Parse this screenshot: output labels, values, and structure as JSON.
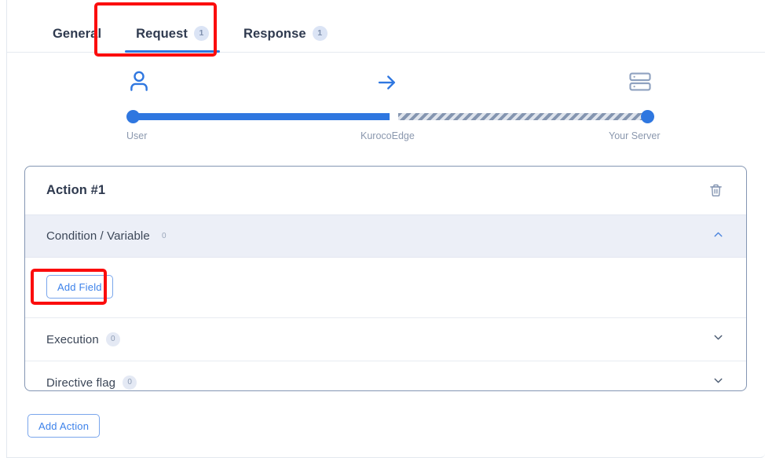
{
  "tabs": [
    {
      "label": "General",
      "badge": null,
      "active": false
    },
    {
      "label": "Request",
      "badge": "1",
      "active": true
    },
    {
      "label": "Response",
      "badge": "1",
      "active": false
    }
  ],
  "flow": {
    "user_icon": "user-icon",
    "arrow_icon": "arrow-right-icon",
    "server_icon": "server-icon",
    "labels": {
      "left": "User",
      "middle": "KurocoEdge",
      "right": "Your Server"
    },
    "colors": {
      "accent": "#2f77e0",
      "striped": "#8495b0",
      "label_text": "#8b98ae"
    }
  },
  "action_card": {
    "title": "Action #1",
    "delete_icon": "trash-icon",
    "sections": [
      {
        "label": "Condition / Variable",
        "count": "0",
        "expanded": true,
        "chevron_icon": "chevron-up-icon",
        "body_button": "Add Field"
      },
      {
        "label": "Execution",
        "count": "0",
        "expanded": false,
        "chevron_icon": "chevron-down-icon"
      },
      {
        "label": "Directive flag",
        "count": "0",
        "expanded": false,
        "chevron_icon": "chevron-down-icon"
      }
    ]
  },
  "footer": {
    "add_action_label": "Add Action"
  },
  "annotations": {
    "highlight_color": "#fb0d0d",
    "boxes": [
      {
        "target": "tab-request"
      },
      {
        "target": "add-field-button"
      }
    ]
  }
}
